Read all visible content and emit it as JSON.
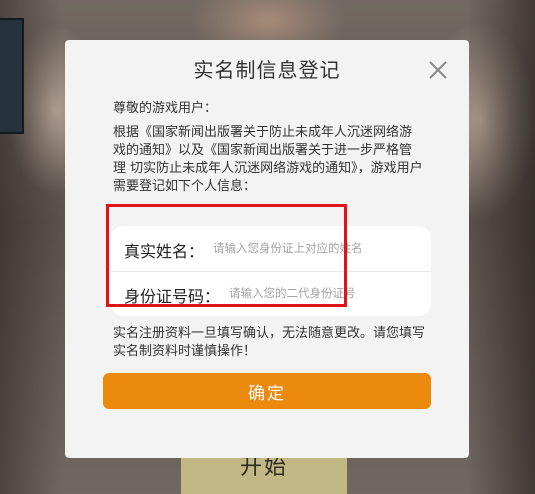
{
  "background": {
    "start_button_text": "开始"
  },
  "dialog": {
    "title": "实名制信息登记",
    "greeting": "尊敬的游戏用户：",
    "notice": "根据《国家新闻出版署关于防止未成年人沉迷网络游戏的通知》以及《国家新闻出版署关于进一步严格管理 切实防止未成年人沉迷网络游戏的通知》，游戏用户需要登记如下个人信息：",
    "fields": {
      "name_label": "真实姓名：",
      "name_placeholder": "请输入您身份证上对应的姓名",
      "id_label": "身份证号码：",
      "id_placeholder": "请输入您的二代身份证号"
    },
    "warning": "实名注册资料一旦填写确认，无法随意更改。请您填写实名制资料时谨慎操作！",
    "confirm_label": "确定"
  },
  "colors": {
    "accent": "#ec8a0e",
    "highlight_border": "#e0121b",
    "dialog_bg": "#f3f3f3"
  },
  "icons": {
    "close": "close-icon"
  }
}
